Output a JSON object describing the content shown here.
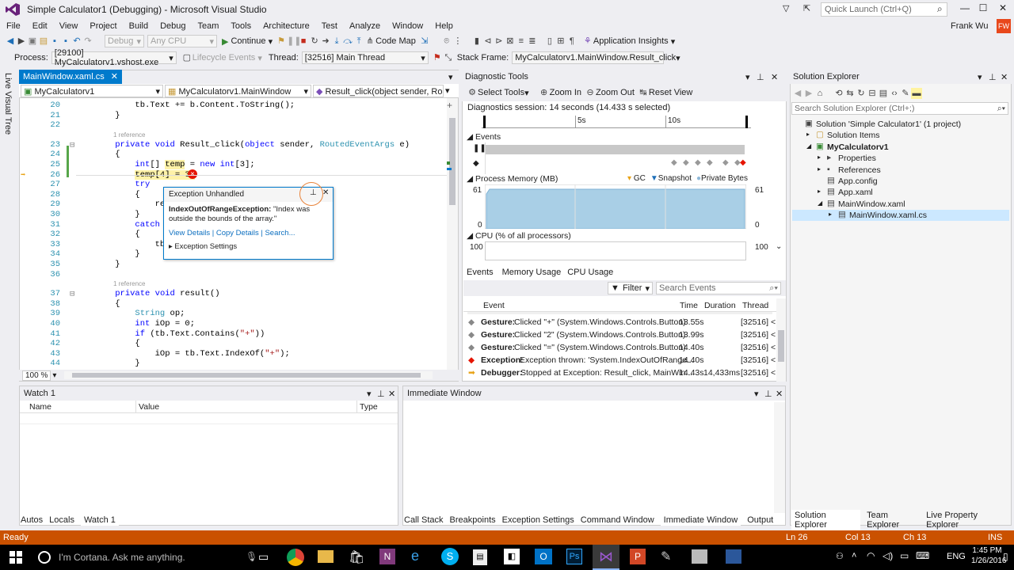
{
  "app": {
    "title": "Simple Calculator1 (Debugging) - Microsoft Visual Studio",
    "quick_launch": "Quick Launch (Ctrl+Q)",
    "user": "Frank Wu",
    "user_initials": "FW"
  },
  "menu": [
    "File",
    "Edit",
    "View",
    "Project",
    "Build",
    "Debug",
    "Team",
    "Tools",
    "Architecture",
    "Test",
    "Analyze",
    "Window",
    "Help"
  ],
  "toolbar1": {
    "config": "Debug",
    "platform": "Any CPU",
    "continue": "Continue",
    "codemap": "Code Map",
    "insights": "Application Insights"
  },
  "toolbar2": {
    "process_label": "Process:",
    "process": "[29100] MyCalculatorv1.vshost.exe",
    "lifecycle": "Lifecycle Events",
    "thread_label": "Thread:",
    "thread": "[32516] Main Thread",
    "stackframe_label": "Stack Frame:",
    "stackframe": "MyCalculatorv1.MainWindow.Result_click"
  },
  "left_strip": "Live Visual Tree",
  "editor": {
    "tab": "MainWindow.xaml.cs",
    "nav1": "MyCalculatorv1",
    "nav2": "MyCalculatorv1.MainWindow",
    "nav3": "Result_click(object sender, RoutedEv",
    "zoom": "100 %",
    "ref1": "1 reference",
    "ref2": "1 reference",
    "lines": [
      {
        "n": "20",
        "t": "        tb.Text += b.Content.ToString();"
      },
      {
        "n": "21",
        "t": "    }"
      },
      {
        "n": "22",
        "t": ""
      },
      {
        "n": "23",
        "t": "    private void Result_click(object sender, RoutedEventArgs e)"
      },
      {
        "n": "24",
        "t": "    {"
      },
      {
        "n": "25",
        "t": "        int[] temp = new int[3];"
      },
      {
        "n": "26",
        "t": "        temp[4] = 3;"
      },
      {
        "n": "27",
        "t": "        try"
      },
      {
        "n": "28",
        "t": "        {"
      },
      {
        "n": "29",
        "t": "            res"
      },
      {
        "n": "30",
        "t": "        }"
      },
      {
        "n": "31",
        "t": "        catch ("
      },
      {
        "n": "32",
        "t": "        {"
      },
      {
        "n": "33",
        "t": "            tb."
      },
      {
        "n": "34",
        "t": "        }"
      },
      {
        "n": "35",
        "t": "    }"
      },
      {
        "n": "36",
        "t": ""
      },
      {
        "n": "37",
        "t": "    private void result()"
      },
      {
        "n": "38",
        "t": "    {"
      },
      {
        "n": "39",
        "t": "        String op;"
      },
      {
        "n": "40",
        "t": "        int iOp = 0;"
      },
      {
        "n": "41",
        "t": "        if (tb.Text.Contains(\"+\"))"
      },
      {
        "n": "42",
        "t": "        {"
      },
      {
        "n": "43",
        "t": "            iOp = tb.Text.IndexOf(\"+\");"
      },
      {
        "n": "44",
        "t": "        }"
      }
    ]
  },
  "exception": {
    "header": "Exception Unhandled",
    "type": "IndexOutOfRangeException:",
    "message": "\"Index was outside the bounds of the array.\"",
    "view_details": "View Details",
    "copy_details": "Copy Details",
    "search": "Search...",
    "settings": "Exception Settings"
  },
  "diag": {
    "title": "Diagnostic Tools",
    "select_tools": "Select Tools",
    "zoom_in": "Zoom In",
    "zoom_out": "Zoom Out",
    "reset_view": "Reset View",
    "session": "Diagnostics session: 14 seconds (14.433 s selected)",
    "tick_5s": "5s",
    "tick_10s": "10s",
    "events_label": "Events",
    "memory_label": "Process Memory (MB)",
    "gc": "GC",
    "snapshot": "Snapshot",
    "private_bytes": "Private Bytes",
    "mem_max_left": "61",
    "mem_max_right": "61",
    "mem_min_left": "0",
    "mem_min_right": "0",
    "cpu_label": "CPU (% of all processors)",
    "cpu_left": "100",
    "cpu_right": "100",
    "tabs": [
      "Events",
      "Memory Usage",
      "CPU Usage"
    ],
    "filter": "Filter",
    "search_events": "Search Events",
    "cols": {
      "event": "Event",
      "time": "Time",
      "duration": "Duration",
      "thread": "Thread"
    },
    "rows": [
      {
        "kind": "Gesture:",
        "text": "Clicked \"+\" (System.Windows.Controls.Button)",
        "time": "13.55s",
        "dur": "",
        "thread": "[32516] <"
      },
      {
        "kind": "Gesture:",
        "text": "Clicked \"2\" (System.Windows.Controls.Button)",
        "time": "13.99s",
        "dur": "",
        "thread": "[32516] <"
      },
      {
        "kind": "Gesture:",
        "text": "Clicked \"=\" (System.Windows.Controls.Button)",
        "time": "14.40s",
        "dur": "",
        "thread": "[32516] <"
      },
      {
        "kind": "Exception:",
        "text": "Exception thrown: 'System.IndexOutOfRange...",
        "time": "14.40s",
        "dur": "",
        "thread": "[32516] <"
      },
      {
        "kind": "Debugger:",
        "text": "Stopped at Exception: Result_click, MainWin...",
        "time": "14.43s",
        "dur": "14,433ms",
        "thread": "[32516] <"
      }
    ]
  },
  "solution": {
    "title": "Solution Explorer",
    "search": "Search Solution Explorer (Ctrl+;)",
    "items": [
      {
        "label": "Solution 'Simple Calculator1' (1 project)",
        "indent": 0,
        "bold": false
      },
      {
        "label": "Solution Items",
        "indent": 1,
        "bold": false
      },
      {
        "label": "MyCalculatorv1",
        "indent": 1,
        "bold": true
      },
      {
        "label": "Properties",
        "indent": 2,
        "bold": false
      },
      {
        "label": "References",
        "indent": 2,
        "bold": false
      },
      {
        "label": "App.config",
        "indent": 2,
        "bold": false
      },
      {
        "label": "App.xaml",
        "indent": 2,
        "bold": false
      },
      {
        "label": "MainWindow.xaml",
        "indent": 2,
        "bold": false
      },
      {
        "label": "MainWindow.xaml.cs",
        "indent": 3,
        "bold": false
      }
    ],
    "tabs": [
      "Solution Explorer",
      "Team Explorer",
      "Live Property Explorer"
    ]
  },
  "watch": {
    "title": "Watch 1",
    "cols": [
      "Name",
      "Value",
      "Type"
    ],
    "tabs": [
      "Autos",
      "Locals",
      "Watch 1"
    ]
  },
  "immediate": {
    "title": "Immediate Window",
    "tabs": [
      "Call Stack",
      "Breakpoints",
      "Exception Settings",
      "Command Window",
      "Immediate Window",
      "Output"
    ]
  },
  "status": {
    "ready": "Ready",
    "ln": "Ln 26",
    "col": "Col 13",
    "ch": "Ch 13",
    "ins": "INS"
  },
  "taskbar": {
    "cortana": "I'm Cortana. Ask me anything.",
    "lang": "ENG",
    "time": "1:45 PM",
    "date": "1/26/2016"
  }
}
